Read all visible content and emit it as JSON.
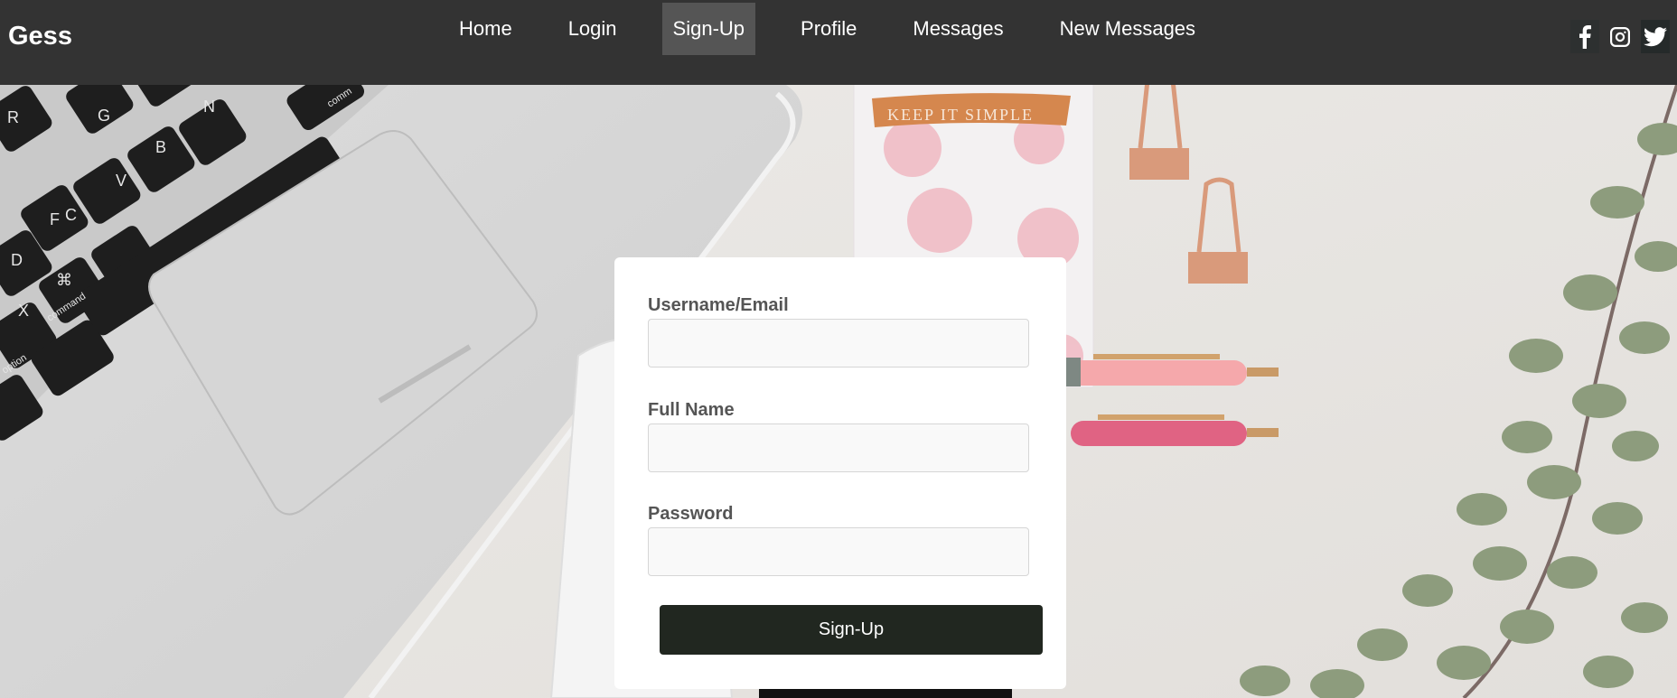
{
  "brand": "Gess",
  "nav": {
    "items": [
      {
        "label": "Home"
      },
      {
        "label": "Login"
      },
      {
        "label": "Sign-Up"
      },
      {
        "label": "Profile"
      },
      {
        "label": "Messages"
      },
      {
        "label": "New Messages"
      }
    ],
    "active": "Sign-Up"
  },
  "social": [
    "facebook-icon",
    "instagram-icon",
    "twitter-icon"
  ],
  "background_text": {
    "notebook": "KEEP IT SIMPLE",
    "keys": [
      "R",
      "G",
      "F",
      "B",
      "N",
      "D",
      "C",
      "V",
      "X",
      "⌘",
      "command",
      "option",
      "comm"
    ]
  },
  "form": {
    "username_label": "Username/Email",
    "username_value": "",
    "fullname_label": "Full Name",
    "fullname_value": "",
    "password_label": "Password",
    "password_value": "",
    "submit_label": "Sign-Up"
  },
  "colors": {
    "navbar": "#333333",
    "active_nav": "#555555",
    "button": "#212720"
  }
}
